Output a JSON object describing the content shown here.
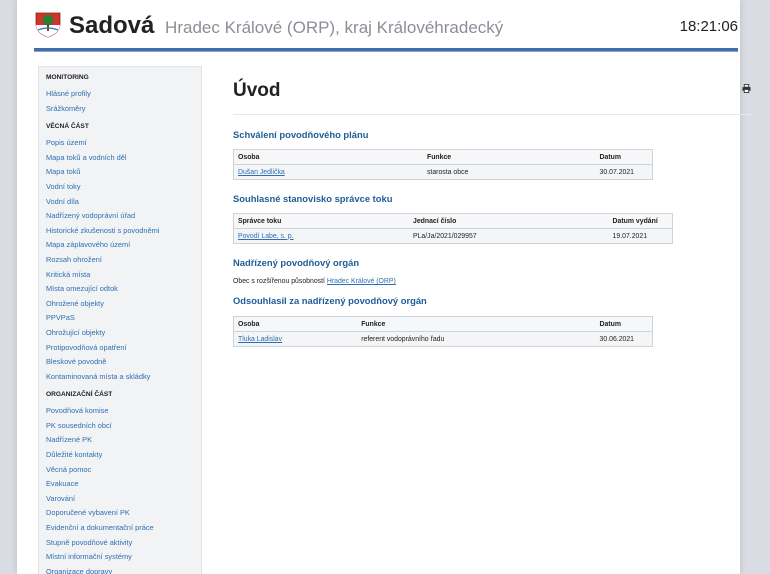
{
  "header": {
    "brand": "Sadová",
    "subtitle": "Hradec Králové (ORP), kraj Královéhradecký",
    "clock": "18:21:06",
    "accent_color": "#3b6fb0"
  },
  "sidebar": {
    "sections": [
      {
        "heading": "Monitoring",
        "items": [
          "Hlásné profily",
          "Srážkoměry"
        ]
      },
      {
        "heading": "Věcná část",
        "items": [
          "Popis území",
          "Mapa toků a vodních děl",
          "Mapa toků",
          "Vodní toky",
          "Vodní díla",
          "Nadřízený vodoprávní úřad",
          "Historické zkušenosti s povodněmi",
          "Mapa záplavového území",
          "Rozsah ohrožení",
          "Kritická místa",
          "Místa omezující odtok",
          "Ohrožené objekty",
          "PPVPaS",
          "Ohrožující objekty",
          "Protipovodňová opatření",
          "Bleskové povodně",
          "Kontaminovaná místa a skládky"
        ]
      },
      {
        "heading": "Organizační část",
        "items": [
          "Povodňová komise",
          "PK sousedních obcí",
          "Nadřízené PK",
          "Důležité kontakty",
          "Věcná pomoc",
          "Evakuace",
          "Varování",
          "Doporučené vybavení PK",
          "Evidenční a dokumentační práce",
          "Stupně povodňové aktivity",
          "Místní informační systémy",
          "Organizace dopravy"
        ]
      }
    ]
  },
  "main": {
    "title": "Úvod",
    "print_icon": "printer-icon",
    "approval": {
      "title": "Schválení povodňového plánu",
      "headers": [
        "Osoba",
        "Funkce",
        "Datum"
      ],
      "rows": [
        [
          "Dušan Jedlička",
          "starosta obce",
          "30.07.2021"
        ]
      ]
    },
    "consent": {
      "title": "Souhlasné stanovisko správce toku",
      "headers": [
        "Správce toku",
        "Jednací číslo",
        "Datum vydání"
      ],
      "rows": [
        [
          "Povodí Labe, s. p.",
          "PLa/Ja/2021/029957",
          "19.07.2021"
        ]
      ]
    },
    "superior": {
      "title": "Nadřízený povodňový orgán",
      "text": "Obec s rozšířenou působností",
      "link": "Hradec Králové (ORP)"
    },
    "agreed": {
      "title": "Odsouhlasil za nadřízený povodňový orgán",
      "headers": [
        "Osoba",
        "Funkce",
        "Datum"
      ],
      "rows": [
        [
          "Tluka Ladislav",
          "referent vodoprávního řadu",
          "30.06.2021"
        ]
      ]
    }
  }
}
